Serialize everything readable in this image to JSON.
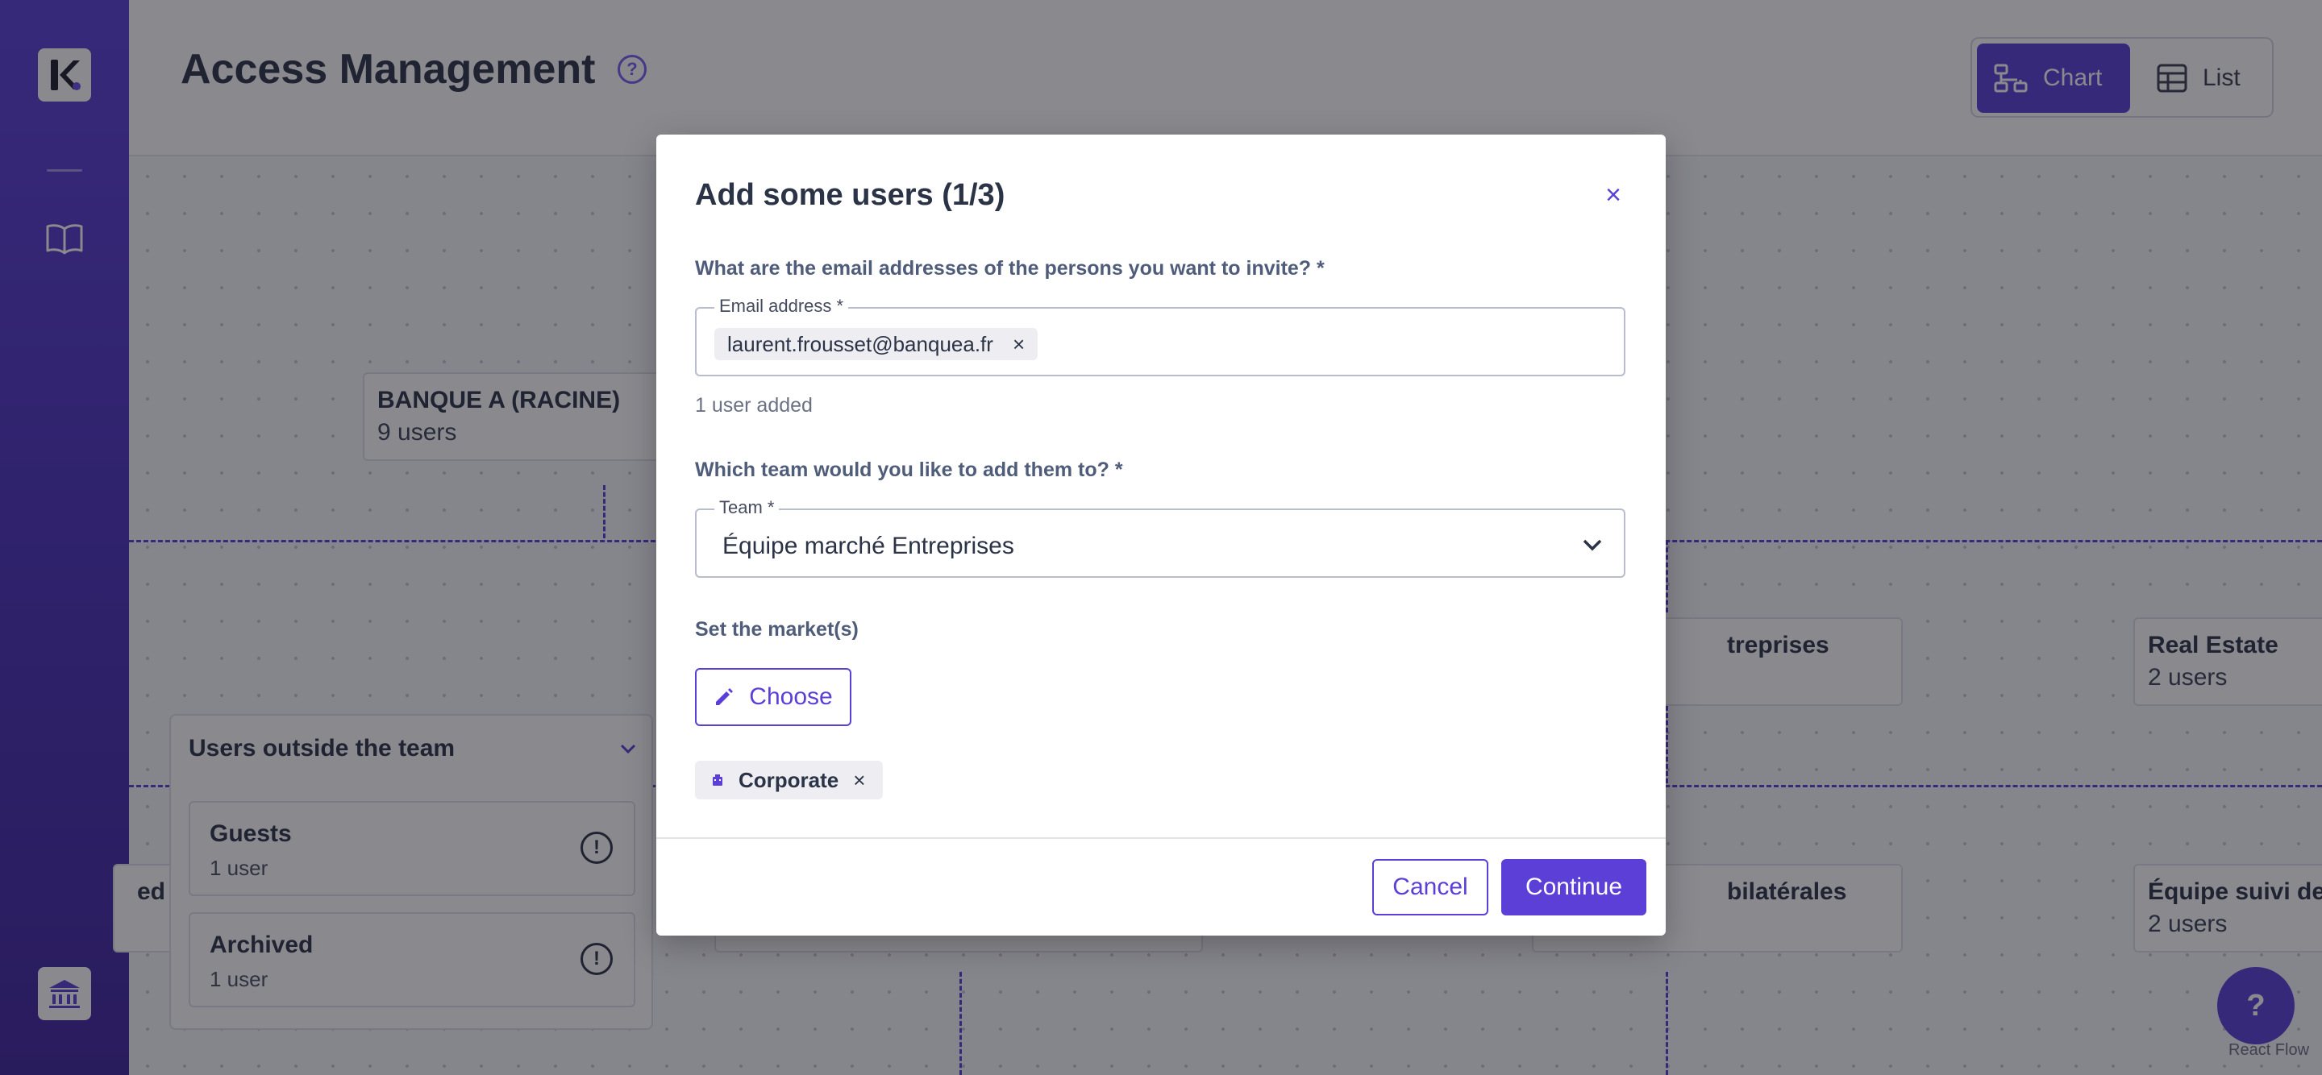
{
  "header": {
    "title": "Access Management",
    "help_symbol": "?",
    "view_toggle": {
      "chart_label": "Chart",
      "list_label": "List",
      "active": "Chart"
    }
  },
  "org_chart": {
    "root": {
      "name": "BANQUE A (RACINE)",
      "count": "9 users"
    },
    "nodes": [
      {
        "name": "treprises",
        "count": ""
      },
      {
        "name": "Real Estate",
        "count": "2 users"
      },
      {
        "name": "bilatérales",
        "count": ""
      },
      {
        "name": "Équipe suivi de",
        "count": "2 users"
      },
      {
        "name": "ed F",
        "count": ""
      }
    ],
    "outside_team": {
      "title": "Users outside the team",
      "groups": [
        {
          "name": "Guests",
          "count": "1 user"
        },
        {
          "name": "Archived",
          "count": "1 user"
        }
      ]
    },
    "attribution": "React Flow"
  },
  "fab": {
    "symbol": "?"
  },
  "modal": {
    "title": "Add some users (1/3)",
    "close_symbol": "×",
    "email_question": "What are the email addresses of the persons you want to invite? *",
    "email_field_label": "Email address *",
    "emails": [
      "laurent.frousset@banquea.fr"
    ],
    "chip_remove_symbol": "×",
    "users_added": "1 user added",
    "team_question": "Which team would you like to add them to? *",
    "team_field_label": "Team *",
    "team_value": "Équipe marché Entreprises",
    "markets_label": "Set the market(s)",
    "choose_label": "Choose",
    "markets": [
      "Corporate"
    ],
    "cancel_label": "Cancel",
    "continue_label": "Continue"
  },
  "colors": {
    "accent": "#5b3fd6",
    "sidebar": "#4a2fb8",
    "overlay": "rgba(20,20,30,0.5)"
  }
}
